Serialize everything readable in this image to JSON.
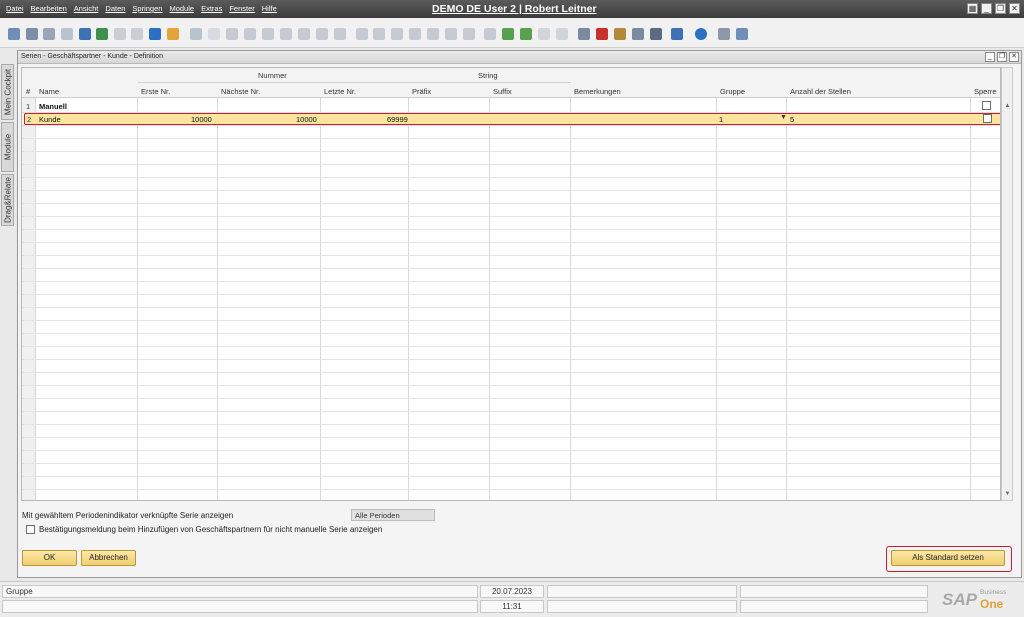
{
  "menu": [
    "Datei",
    "Bearbeiten",
    "Ansicht",
    "Daten",
    "Springen",
    "Module",
    "Extras",
    "Fenster",
    "Hilfe"
  ],
  "app_title": "DEMO DE User 2 | Robert Leitner",
  "side_tabs": [
    "Mein Cockpit",
    "Module",
    "Drag&Relate"
  ],
  "form": {
    "title": "Serien - Geschäftspartner - Kunde - Definition",
    "group_headers": {
      "number": "Nummer",
      "string": "String"
    },
    "columns": [
      "#",
      "Name",
      "Erste Nr.",
      "Nächste Nr.",
      "Letzte Nr.",
      "Präfix",
      "Suffix",
      "Bemerkungen",
      "Gruppe",
      "Anzahl der Stellen",
      "Sperre"
    ],
    "rows": [
      {
        "num": "1",
        "name": "Manuell",
        "first": "",
        "next": "",
        "last": "",
        "prefix": "",
        "suffix": "",
        "remarks": "",
        "group": "",
        "digits": ""
      },
      {
        "num": "2",
        "name": "Kunde",
        "first": "10000",
        "next": "10000",
        "last": "69999",
        "prefix": "",
        "suffix": "",
        "remarks": "",
        "group": "1",
        "digits": "5"
      }
    ],
    "option1_label": "Mit gewähltem Periodenindikator verknüpfte Serie anzeigen",
    "periods_value": "Alle Perioden",
    "option2_label": "Bestätigungsmeldung beim Hinzufügen von Geschäftspartnern für nicht manuelle Serie anzeigen",
    "ok_label": "OK",
    "cancel_label": "Abbrechen",
    "set_default_label": "Als Standard setzen"
  },
  "status": {
    "field_label": "Gruppe",
    "date": "20.07.2023",
    "time": "11:31"
  },
  "brand": {
    "logo": "SAP",
    "business": "Business",
    "one": "One"
  }
}
